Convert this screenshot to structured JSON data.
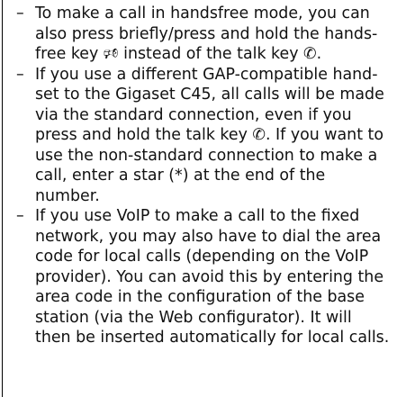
{
  "bullet": "–",
  "icons": {
    "handsfree_key": "🕫",
    "talk_key": "✆"
  },
  "notes": [
    {
      "text_1": "To make a call in handsfree mode, you can also press briefly/press and hold the hands-free key ",
      "text_2": " instead of the talk key ",
      "text_3": "."
    },
    {
      "text_1": "If you use a different GAP-compatible hand-set to the Gigaset C45, all calls will be made via the standard connection, even if you press and hold the talk key ",
      "text_2": ". If you want to use the non-standard connection to make a call, enter a star (*) at the end of the number."
    },
    {
      "text_1": "If you use VoIP to make a call to the fixed network, you may also have to dial the area code for local calls (depending on the VoIP provider). You can avoid this by entering the area code in the configuration of the base station (via the Web configurator). It will then be inserted automatically for local calls."
    }
  ]
}
